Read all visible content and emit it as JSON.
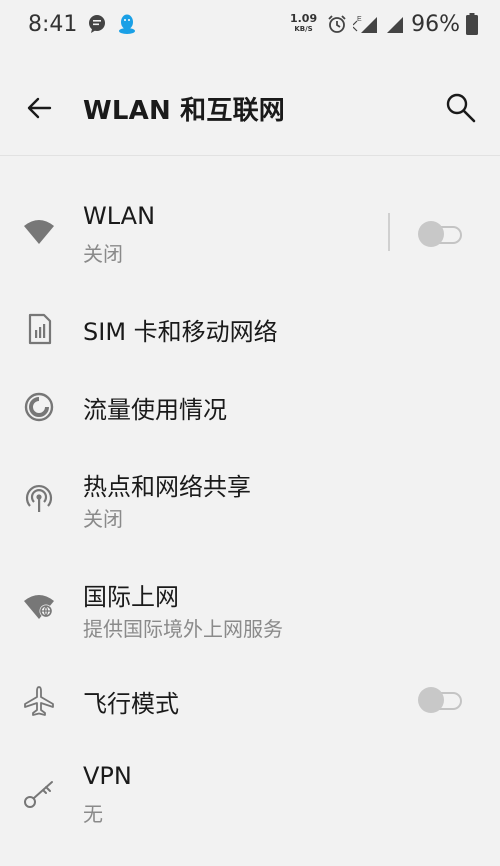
{
  "status_bar": {
    "time": "8:41",
    "speed_value": "1.09",
    "speed_unit": "KB/S",
    "network_type": "E",
    "battery_percent": "96%"
  },
  "app_bar": {
    "title": "WLAN 和互联网"
  },
  "items": [
    {
      "label": "WLAN",
      "sub": "关闭",
      "icon": "wifi-icon",
      "toggle": "off"
    },
    {
      "label": "SIM 卡和移动网络",
      "icon": "sim-card-icon"
    },
    {
      "label": "流量使用情况",
      "icon": "data-usage-icon"
    },
    {
      "label": "热点和网络共享",
      "sub": "关闭",
      "icon": "hotspot-icon"
    },
    {
      "label": "国际上网",
      "sub": "提供国际境外上网服务",
      "icon": "global-wifi-icon"
    },
    {
      "label": "飞行模式",
      "icon": "airplane-icon",
      "toggle": "off"
    },
    {
      "label": "VPN",
      "sub": "无",
      "icon": "vpn-key-icon"
    }
  ],
  "colors": {
    "background": "#f2f2f2",
    "text_primary": "#1a1a1a",
    "text_secondary": "#8a8a8a",
    "icon": "#777777",
    "toggle_off": "#c8c8c8"
  }
}
